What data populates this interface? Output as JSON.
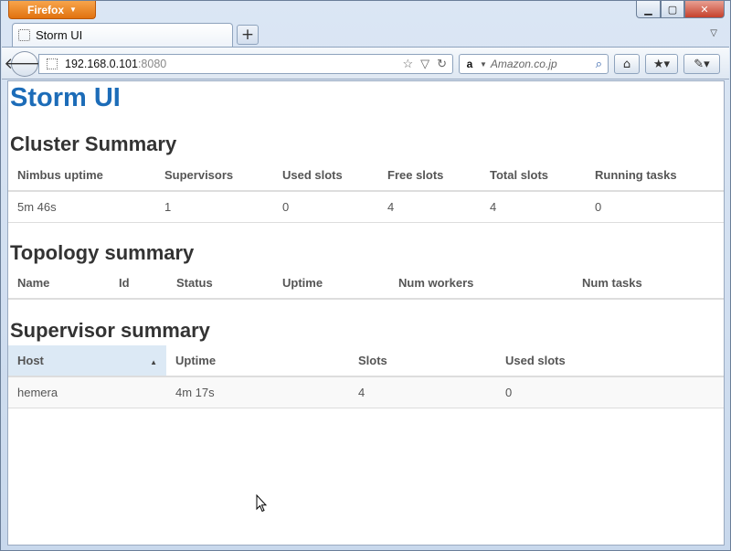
{
  "browser": {
    "menu_label": "Firefox",
    "tab_title": "Storm UI",
    "url_host": "192.168.0.101",
    "url_port": ":8080",
    "search_placeholder": "Amazon.co.jp",
    "new_tab_symbol": "+"
  },
  "page": {
    "title": "Storm UI"
  },
  "cluster": {
    "heading": "Cluster Summary",
    "columns": [
      "Nimbus uptime",
      "Supervisors",
      "Used slots",
      "Free slots",
      "Total slots",
      "Running tasks"
    ],
    "row": [
      "5m 46s",
      "1",
      "0",
      "4",
      "4",
      "0"
    ]
  },
  "topology": {
    "heading": "Topology summary",
    "columns": [
      "Name",
      "Id",
      "Status",
      "Uptime",
      "Num workers",
      "Num tasks"
    ]
  },
  "supervisor": {
    "heading": "Supervisor summary",
    "columns": [
      "Host",
      "Uptime",
      "Slots",
      "Used slots"
    ],
    "row": [
      "hemera",
      "4m 17s",
      "4",
      "0"
    ]
  },
  "colors": {
    "title": "#1c6cb8",
    "firefox_button": "#e1720f",
    "sorted_header": "#dce9f5"
  },
  "icons": [
    "back-arrow-icon",
    "favicon-placeholder-icon",
    "star-icon",
    "dropdown-icon",
    "reload-icon",
    "amazon-icon",
    "search-icon",
    "home-icon",
    "bookmarks-icon",
    "addon-icon",
    "sort-ascending-icon",
    "mouse-cursor-icon"
  ]
}
